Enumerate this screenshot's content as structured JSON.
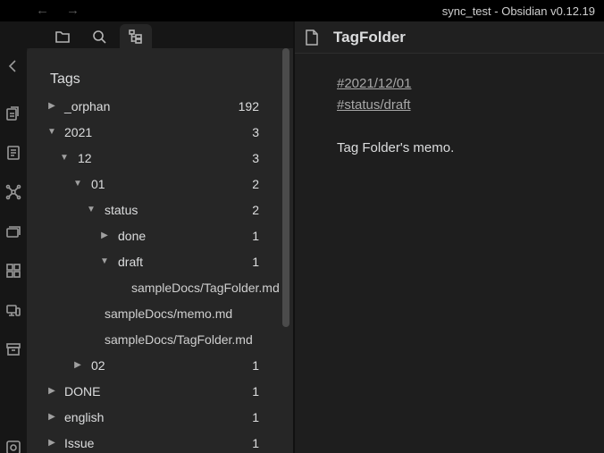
{
  "window": {
    "title": "sync_test - Obsidian v0.12.19",
    "back_glyph": "←",
    "forward_glyph": "→"
  },
  "ribbon": {
    "collapse_glyph": "<",
    "icons": [
      "open-quick-switcher-icon",
      "daily-note-icon",
      "graph-view-icon",
      "slides-icon",
      "plugins-icon",
      "publish-icon",
      "archive-icon",
      "vault-icon"
    ]
  },
  "left_tabs": [
    "file-explorer-icon",
    "search-icon",
    "tag-folder-icon"
  ],
  "tags": {
    "heading": "Tags",
    "rows": [
      {
        "arrow": "▶",
        "label": "_orphan",
        "count": "192"
      },
      {
        "arrow": "▼",
        "label": "2021",
        "count": "3"
      },
      {
        "arrow": "▼",
        "label": "12",
        "count": "3"
      },
      {
        "arrow": "▼",
        "label": "01",
        "count": "2"
      },
      {
        "arrow": "▼",
        "label": "status",
        "count": "2"
      },
      {
        "arrow": "▶",
        "label": "done",
        "count": "1"
      },
      {
        "arrow": "▼",
        "label": "draft",
        "count": "1"
      },
      {
        "arrow": "",
        "label": "sampleDocs/TagFolder.md",
        "count": ""
      },
      {
        "arrow": "",
        "label": "sampleDocs/memo.md",
        "count": ""
      },
      {
        "arrow": "",
        "label": "sampleDocs/TagFolder.md",
        "count": ""
      },
      {
        "arrow": "▶",
        "label": "02",
        "count": "1"
      },
      {
        "arrow": "▶",
        "label": "DONE",
        "count": "1"
      },
      {
        "arrow": "▶",
        "label": "english",
        "count": "1"
      },
      {
        "arrow": "▶",
        "label": "Issue",
        "count": "1"
      }
    ]
  },
  "editor": {
    "title": "TagFolder",
    "tags": [
      "#2021/12/01",
      "#status/draft"
    ],
    "body": "Tag Folder's memo."
  }
}
